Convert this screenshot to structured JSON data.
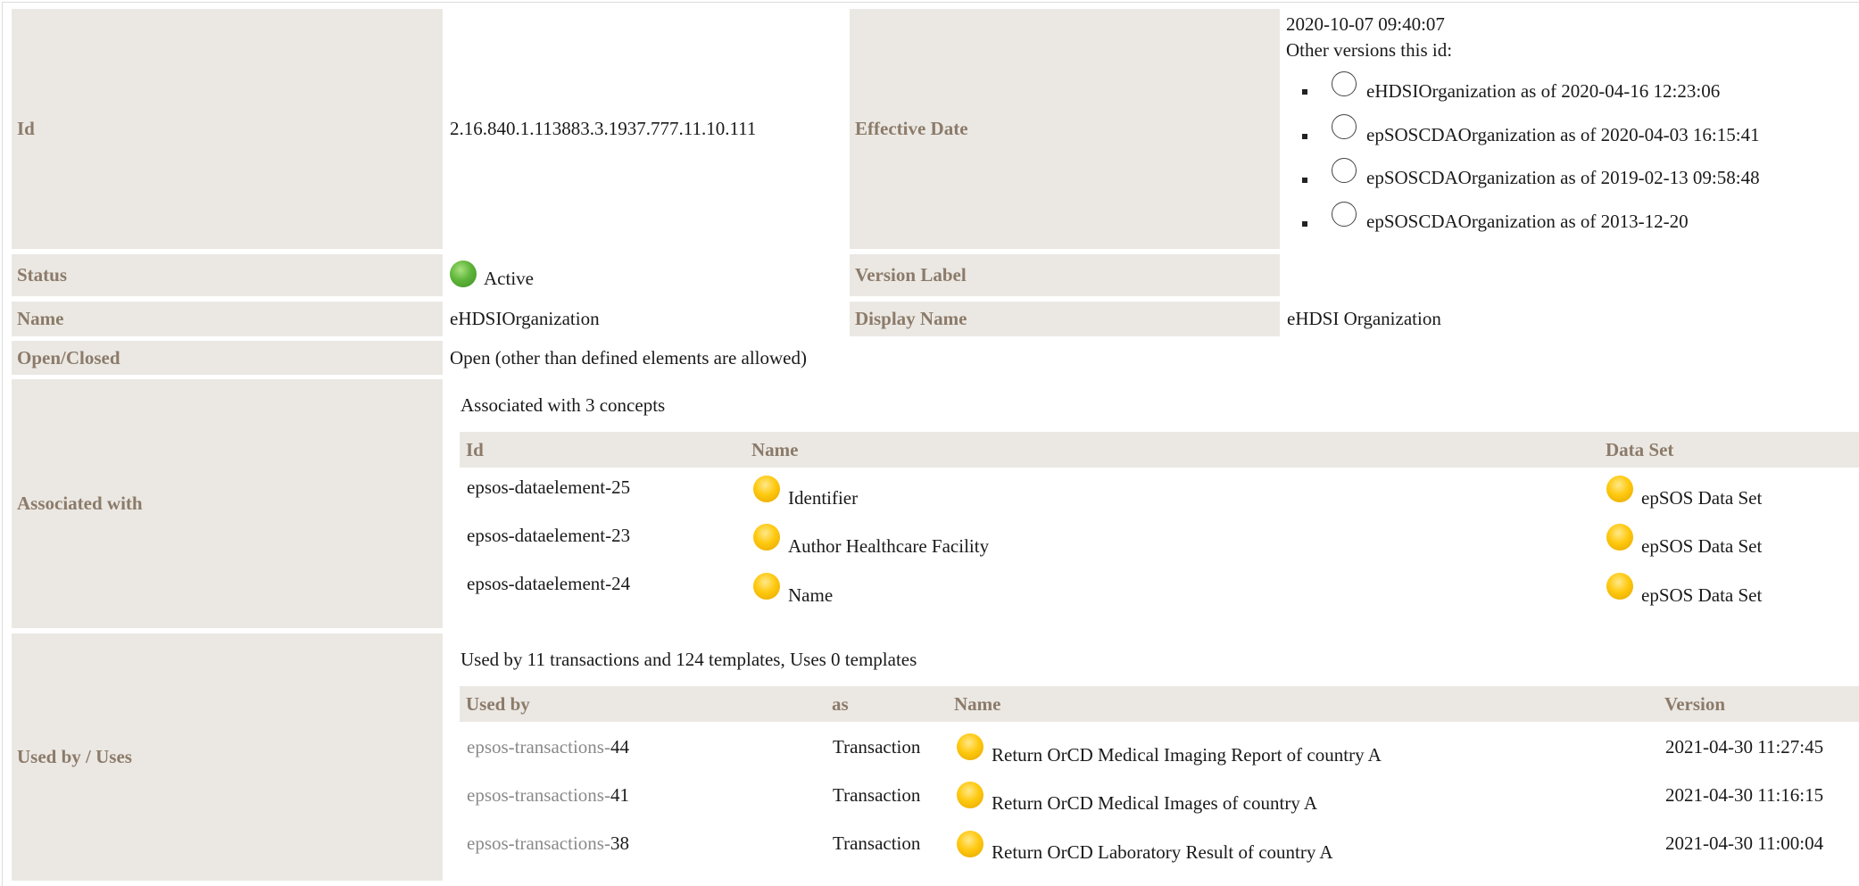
{
  "props": {
    "id": {
      "label": "Id",
      "value": "2.16.840.1.113883.3.1937.777.11.10.111"
    },
    "effective": {
      "label": "Effective Date",
      "date": "2020-10-07 09:40:07",
      "other_label": "Other versions this id:",
      "versions": [
        "eHDSIOrganization as of 2020-04-16 12:23:06",
        "epSOSCDAOrganization as of 2020-04-03 16:15:41",
        "epSOSCDAOrganization as of 2019-02-13 09:58:48",
        "epSOSCDAOrganization as of 2013-12-20"
      ]
    },
    "status": {
      "label": "Status",
      "value": "Active",
      "color": "#5fb53a"
    },
    "version_label": {
      "label": "Version Label",
      "value": ""
    },
    "name": {
      "label": "Name",
      "value": "eHDSIOrganization"
    },
    "display_name": {
      "label": "Display Name",
      "value": "eHDSI Organization"
    },
    "open_closed": {
      "label": "Open/Closed",
      "value": "Open (other than defined elements are allowed)"
    }
  },
  "associated": {
    "label": "Associated with",
    "summary": "Associated with 3 concepts",
    "headers": {
      "id": "Id",
      "name": "Name",
      "dataset": "Data Set"
    },
    "rows": [
      {
        "id": "epsos-dataelement-25",
        "name": "Identifier",
        "dataset": "epSOS Data Set"
      },
      {
        "id": "epsos-dataelement-23",
        "name": "Author Healthcare Facility",
        "dataset": "epSOS Data Set"
      },
      {
        "id": "epsos-dataelement-24",
        "name": "Name",
        "dataset": "epSOS Data Set"
      }
    ]
  },
  "usedby": {
    "label": "Used by / Uses",
    "summary": "Used by 11 transactions and 124 templates, Uses 0 templates",
    "headers": {
      "usedby": "Used by",
      "as": "as",
      "name": "Name",
      "version": "Version"
    },
    "rows": [
      {
        "prefix": "epsos-transactions-",
        "num": "44",
        "as": "Transaction",
        "name": "Return OrCD Medical Imaging Report of country A",
        "version": "2021-04-30 11:27:45"
      },
      {
        "prefix": "epsos-transactions-",
        "num": "41",
        "as": "Transaction",
        "name": "Return OrCD Medical Images of country A",
        "version": "2021-04-30 11:16:15"
      },
      {
        "prefix": "epsos-transactions-",
        "num": "38",
        "as": "Transaction",
        "name": "Return OrCD Laboratory Result of country A",
        "version": "2021-04-30 11:00:04"
      }
    ]
  },
  "colors": {
    "label_bg": "#ebe8e3",
    "label_text": "#8c7b6a",
    "active": "#5fb53a",
    "concept": "#ffc90f"
  }
}
